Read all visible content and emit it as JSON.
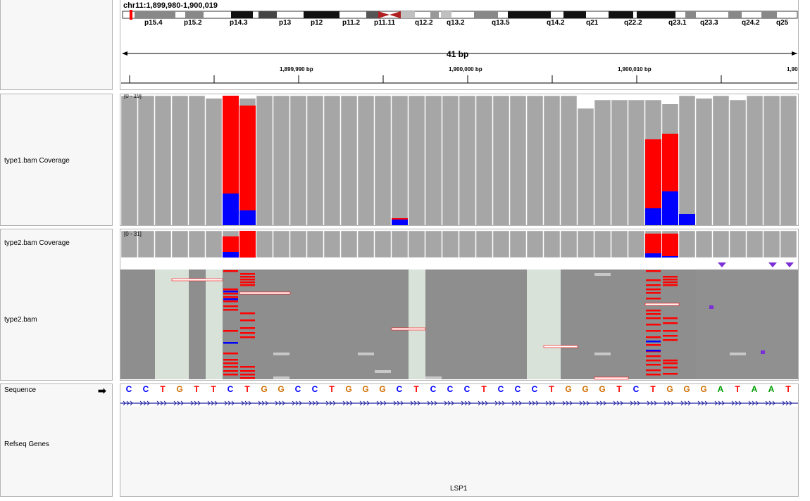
{
  "locus": "chr11:1,899,980-1,900,019",
  "span": "41 bp",
  "ideogram_bands": [
    "p15.4",
    "p15.2",
    "p14.3",
    "p13",
    "p12",
    "p11.2",
    "p11.11",
    "q12.2",
    "q13.2",
    "q13.5",
    "q14.2",
    "q21",
    "q22.2",
    "q23.1",
    "q23.3",
    "q24.2",
    "q25"
  ],
  "positions": [
    "1,899,990 bp",
    "1,900,000 bp",
    "1,900,010 bp",
    "1,90"
  ],
  "tracks": {
    "type1_coverage": {
      "name": "type1.bam Coverage",
      "scale": "[0 - 19]"
    },
    "type2_coverage": {
      "name": "type2.bam Coverage",
      "scale": "[0 - 31]"
    },
    "type2_reads": {
      "name": "type2.bam"
    },
    "sequence": {
      "name": "Sequence"
    },
    "refseq": {
      "name": "Refseq Genes"
    }
  },
  "sequence": [
    "C",
    "C",
    "T",
    "G",
    "T",
    "T",
    "C",
    "T",
    "G",
    "G",
    "C",
    "C",
    "T",
    "G",
    "G",
    "G",
    "C",
    "T",
    "C",
    "C",
    "C",
    "T",
    "C",
    "C",
    "C",
    "T",
    "G",
    "G",
    "G",
    "T",
    "C",
    "T",
    "G",
    "G",
    "G",
    "A",
    "T",
    "A",
    "A",
    "T"
  ],
  "gene": "LSP1",
  "base_colors": {
    "A": "#00a000",
    "C": "#0000ff",
    "G": "#d17105",
    "T": "#ff0000"
  },
  "mismatch_colors": {
    "ref": "#ff0000",
    "alt": "#0000ff"
  }
}
